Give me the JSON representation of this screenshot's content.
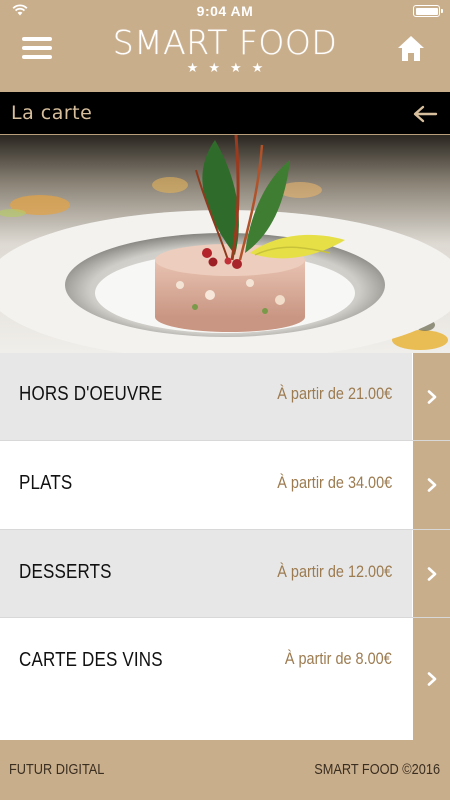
{
  "status_bar": {
    "time": "9:04 AM"
  },
  "header": {
    "brand": "SMART FOOD",
    "stars": "★★★★",
    "menu_icon": "hamburger-icon",
    "home_icon": "home-icon"
  },
  "section": {
    "title": "La carte",
    "back_icon": "arrow-left-icon"
  },
  "hero": {
    "image": "plated-tartare-with-herb-garnish"
  },
  "menu": {
    "items": [
      {
        "label": "HORS D'OEUVRE",
        "price": "À partir de 21.00€"
      },
      {
        "label": "PLATS",
        "price": "À partir de 34.00€"
      },
      {
        "label": "DESSERTS",
        "price": "À partir de 12.00€"
      },
      {
        "label": "CARTE DES VINS",
        "price": "À partir de 8.00€"
      }
    ],
    "chevron_icon": "chevron-right-icon"
  },
  "footer": {
    "left": "FUTUR DIGITAL",
    "right": "SMART FOOD ©2016"
  },
  "colors": {
    "accent": "#c9ae8c",
    "section_bar": "#000000",
    "price_text": "#9c7b50",
    "row_grey": "#e7e7e7"
  }
}
